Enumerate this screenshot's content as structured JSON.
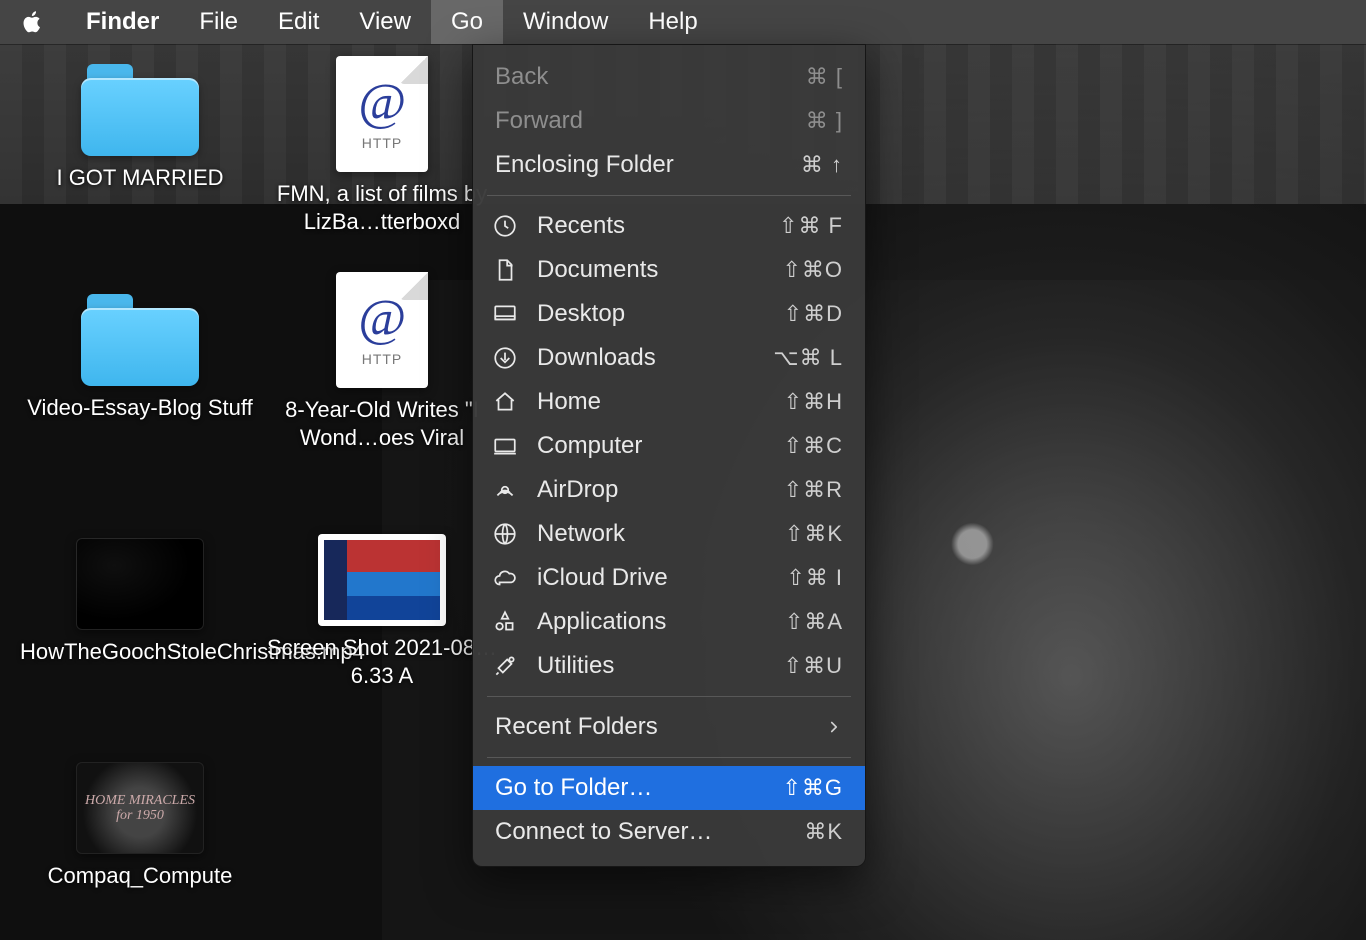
{
  "menubar": {
    "app": "Finder",
    "items": [
      "File",
      "Edit",
      "View",
      "Go",
      "Window",
      "Help"
    ],
    "active_index": 3
  },
  "desktop_icons": [
    {
      "kind": "folder",
      "label": "I GOT MARRIED"
    },
    {
      "kind": "webloc",
      "at": "@",
      "sub": "HTTP",
      "label": "FMN, a list of films by LizBa…tterboxd"
    },
    {
      "kind": "folder",
      "label": "Video-Essay-Blog Stuff"
    },
    {
      "kind": "webloc",
      "at": "@",
      "sub": "HTTP",
      "label": "8-Year-Old Writes \"I Wond…oes Viral"
    },
    {
      "kind": "video",
      "label": "HowTheGoochStoleChristmas.mp4"
    },
    {
      "kind": "screenshot",
      "label": "Screen Shot 2021-08…6.33 A"
    },
    {
      "kind": "video-poster",
      "poster_text": "HOME MIRACLES for 1950",
      "label": "Compaq_Compute"
    }
  ],
  "go_menu": {
    "top": [
      {
        "label": "Back",
        "shortcut": "⌘ [",
        "disabled": true
      },
      {
        "label": "Forward",
        "shortcut": "⌘ ]",
        "disabled": true
      },
      {
        "label": "Enclosing Folder",
        "shortcut": "⌘ ↑",
        "disabled": false
      }
    ],
    "places": [
      {
        "icon": "clock",
        "label": "Recents",
        "shortcut": "⇧⌘ F"
      },
      {
        "icon": "doc",
        "label": "Documents",
        "shortcut": "⇧⌘O"
      },
      {
        "icon": "desktop",
        "label": "Desktop",
        "shortcut": "⇧⌘D"
      },
      {
        "icon": "download",
        "label": "Downloads",
        "shortcut": "⌥⌘ L"
      },
      {
        "icon": "home",
        "label": "Home",
        "shortcut": "⇧⌘H"
      },
      {
        "icon": "computer",
        "label": "Computer",
        "shortcut": "⇧⌘C"
      },
      {
        "icon": "airdrop",
        "label": "AirDrop",
        "shortcut": "⇧⌘R"
      },
      {
        "icon": "network",
        "label": "Network",
        "shortcut": "⇧⌘K"
      },
      {
        "icon": "cloud",
        "label": "iCloud Drive",
        "shortcut": "⇧⌘ I"
      },
      {
        "icon": "apps",
        "label": "Applications",
        "shortcut": "⇧⌘A"
      },
      {
        "icon": "utilities",
        "label": "Utilities",
        "shortcut": "⇧⌘U"
      }
    ],
    "recent_folders": {
      "label": "Recent Folders"
    },
    "bottom": [
      {
        "label": "Go to Folder…",
        "shortcut": "⇧⌘G",
        "highlight": true
      },
      {
        "label": "Connect to Server…",
        "shortcut": "⌘K"
      }
    ]
  }
}
